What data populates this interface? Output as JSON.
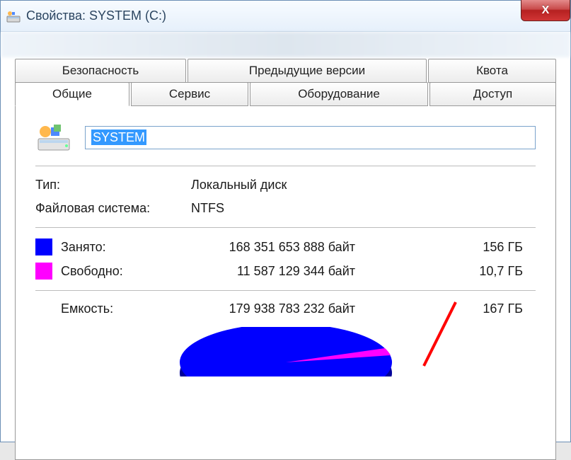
{
  "window": {
    "title": "Свойства: SYSTEM (C:)",
    "close_label": "X"
  },
  "tabs": {
    "back": [
      {
        "label": "Безопасность"
      },
      {
        "label": "Предыдущие версии"
      },
      {
        "label": "Квота"
      }
    ],
    "front": [
      {
        "label": "Общие",
        "active": true
      },
      {
        "label": "Сервис"
      },
      {
        "label": "Оборудование"
      },
      {
        "label": "Доступ"
      }
    ]
  },
  "general": {
    "name_value": "SYSTEM",
    "type_label": "Тип:",
    "type_value": "Локальный диск",
    "fs_label": "Файловая система:",
    "fs_value": "NTFS",
    "used": {
      "label": "Занято:",
      "bytes": "168 351 653 888 байт",
      "gb": "156 ГБ",
      "color": "#0000ff"
    },
    "free": {
      "label": "Свободно:",
      "bytes": "11 587 129 344 байт",
      "gb": "10,7 ГБ",
      "color": "#ff00ff"
    },
    "capacity": {
      "label": "Емкость:",
      "bytes": "179 938 783 232 байт",
      "gb": "167 ГБ"
    }
  },
  "chart_data": {
    "type": "pie",
    "title": "",
    "series": [
      {
        "name": "Занято",
        "value": 168351653888,
        "color": "#0000ff"
      },
      {
        "name": "Свободно",
        "value": 11587129344,
        "color": "#ff00ff"
      }
    ]
  }
}
